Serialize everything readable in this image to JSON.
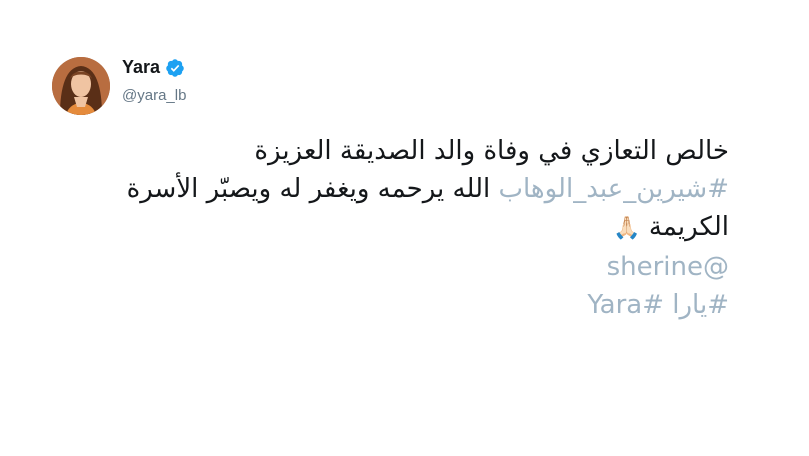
{
  "author": {
    "display_name": "Yara",
    "handle": "@yara_lb",
    "verified": true,
    "avatar_icon": "profile-photo"
  },
  "tweet": {
    "line1": "خالص التعازي في وفاة والد الصديقة العزيزة",
    "hashtag": "#شيرين_عبد_الوهاب",
    "line2_rest": " الله يرحمه ويغفر له ويصبّر الأسرة",
    "line3_text": "الكريمة ",
    "line3_emoji": "🙏🏻",
    "mention": "@sherine",
    "hashtags_end": "#يارا #Yara"
  },
  "colors": {
    "text": "#14171a",
    "link": "#a0b4c4",
    "secondary": "#657786",
    "verified_badge": "#1da1f2"
  }
}
